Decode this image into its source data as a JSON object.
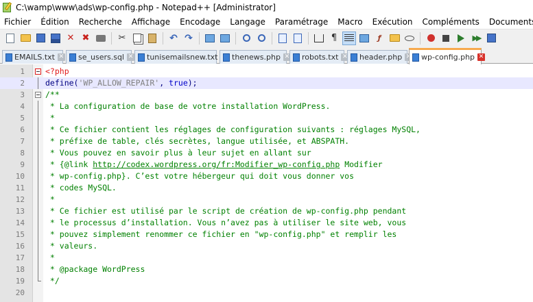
{
  "window": {
    "title": "C:\\wamp\\www\\ads\\wp-config.php - Notepad++ [Administrator]"
  },
  "menu": [
    "Fichier",
    "Édition",
    "Recherche",
    "Affichage",
    "Encodage",
    "Langage",
    "Paramétrage",
    "Macro",
    "Exécution",
    "Compléments",
    "Documents",
    "?"
  ],
  "toolbar": {
    "buttons": [
      "new",
      "open",
      "save",
      "save-all",
      "close",
      "close-all",
      "print",
      "cut",
      "copy",
      "paste",
      "undo",
      "redo",
      "find",
      "replace",
      "zoom-in",
      "zoom-out",
      "sync-v",
      "sync-h",
      "word-wrap",
      "show-all-chars",
      "indent-guide",
      "document-map",
      "function-list",
      "folder-as-workspace",
      "monitoring",
      "record-macro",
      "stop-record",
      "play-macro",
      "run-macro-multiple",
      "save-macro"
    ]
  },
  "tabs": [
    {
      "label": "EMAILS.txt",
      "active": false
    },
    {
      "label": "se_users.sql",
      "active": false
    },
    {
      "label": "tunisemailsnew.txt",
      "active": false
    },
    {
      "label": "thenews.php",
      "active": false
    },
    {
      "label": "robots.txt",
      "active": false
    },
    {
      "label": "header.php",
      "active": false
    },
    {
      "label": "wp-config.php",
      "active": true
    }
  ],
  "editor": {
    "current_line": 2,
    "lines": [
      {
        "n": "1",
        "text": "<?php"
      },
      {
        "n": "2",
        "text": "define('WP_ALLOW_REPAIR', true);"
      },
      {
        "n": "3",
        "text": "/**"
      },
      {
        "n": "4",
        "text": " * La configuration de base de votre installation WordPress."
      },
      {
        "n": "5",
        "text": " *"
      },
      {
        "n": "6",
        "text": " * Ce fichier contient les réglages de configuration suivants : réglages MySQL,"
      },
      {
        "n": "7",
        "text": " * préfixe de table, clés secrètes, langue utilisée, et ABSPATH."
      },
      {
        "n": "8",
        "text": " * Vous pouvez en savoir plus à leur sujet en allant sur"
      },
      {
        "n": "9",
        "text": " * {@link http://codex.wordpress.org/fr:Modifier_wp-config.php Modifier"
      },
      {
        "n": "10",
        "text": " * wp-config.php}. C’est votre hébergeur qui doit vous donner vos"
      },
      {
        "n": "11",
        "text": " * codes MySQL."
      },
      {
        "n": "12",
        "text": " *"
      },
      {
        "n": "13",
        "text": " * Ce fichier est utilisé par le script de création de wp-config.php pendant"
      },
      {
        "n": "14",
        "text": " * le processus d’installation. Vous n’avez pas à utiliser le site web, vous"
      },
      {
        "n": "15",
        "text": " * pouvez simplement renommer ce fichier en \"wp-config.php\" et remplir les"
      },
      {
        "n": "16",
        "text": " * valeurs."
      },
      {
        "n": "17",
        "text": " *"
      },
      {
        "n": "18",
        "text": " * @package WordPress"
      },
      {
        "n": "19",
        "text": " */"
      },
      {
        "n": "20",
        "text": ""
      }
    ],
    "define_parts": {
      "fn": "define",
      "open": "(",
      "arg": "'WP_ALLOW_REPAIR'",
      "sep": ", ",
      "val": "true",
      "close": ");"
    },
    "link": {
      "prefix": " * {@link ",
      "url": "http://codex.wordpress.org/fr:Modifier_wp-config.php",
      "suffix": " Modifier"
    }
  },
  "colors": {
    "php_tag": "#e01a1a",
    "keyword": "#0000c8",
    "string": "#808080",
    "comment": "#008000",
    "current_line_bg": "#e8e8ff",
    "active_tab_accent": "#f7a94d"
  }
}
